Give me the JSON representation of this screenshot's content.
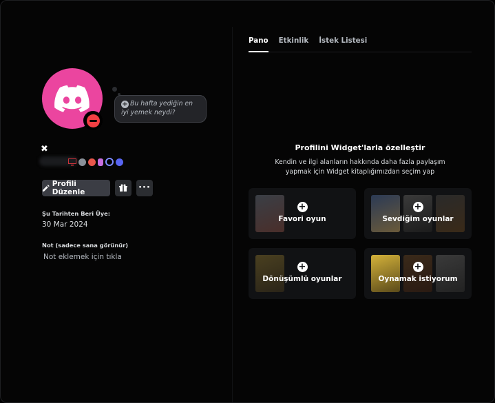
{
  "profile": {
    "status_bubble_text": "Bu hafta yediğin en iyi yemek neydi?",
    "x_badge": "✖",
    "edit_button": "Profili Düzenle",
    "member_since_label": "Şu Tarihten Beri Üye:",
    "member_since_value": "30 Mar 2024",
    "note_label": "Not (sadece sana görünür)",
    "note_placeholder": "Not eklemek için tıkla"
  },
  "tabs": [
    {
      "label": "Pano"
    },
    {
      "label": "Etkinlik"
    },
    {
      "label": "İstek Listesi"
    }
  ],
  "promo": {
    "title": "Profilini Widget'larla özelleştir",
    "description_line1": "Kendin ve ilgi alanların hakkında daha fazla paylaşım",
    "description_line2": "yapmak için Widget kitaplığımızdan seçim yap"
  },
  "cards": [
    {
      "label": "Favori oyun"
    },
    {
      "label": "Sevdiğim oyunlar"
    },
    {
      "label": "Dönüşümlü oyunlar"
    },
    {
      "label": "Oynamak istiyorum"
    }
  ],
  "colors": {
    "avatar_bg": "#eb459f",
    "status_dnd": "#f23f43"
  }
}
